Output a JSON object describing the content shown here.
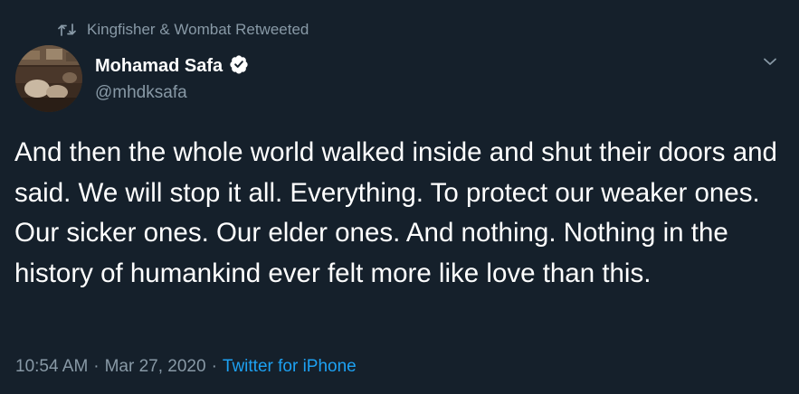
{
  "retweet": {
    "label": "Kingfisher & Wombat Retweeted",
    "icon": "retweet-icon"
  },
  "author": {
    "display_name": "Mohamad Safa",
    "handle": "@mhdksafa",
    "verified": true,
    "verified_icon": "verified-badge-icon"
  },
  "menu": {
    "icon": "chevron-down-icon"
  },
  "tweet": {
    "text": "And then the whole world walked inside and shut their doors and said. We will stop it all. Everything. To protect our weaker ones. Our sicker ones. Our elder ones. And nothing. Nothing in the history of humankind ever felt more like love than this."
  },
  "meta": {
    "time": "10:54 AM",
    "date": "Mar 27, 2020",
    "separator": "·",
    "source": "Twitter for iPhone"
  },
  "colors": {
    "background": "#15202b",
    "text": "#ffffff",
    "muted": "#8899a6",
    "accent": "#1da1f2"
  }
}
